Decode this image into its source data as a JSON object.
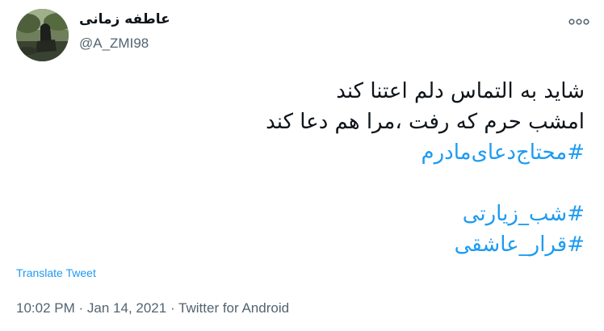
{
  "colors": {
    "text": "#0f1419",
    "secondary": "#536471",
    "link": "#1d9bf0",
    "background": "#ffffff"
  },
  "user": {
    "display_name": "عاطفه زمانی",
    "handle": "@A_ZMI98",
    "avatar_icon": "user-avatar-photo"
  },
  "header": {
    "more_icon": "more-dots-icon"
  },
  "tweet": {
    "lines": [
      "شاید به التماس دلم اعتنا کند",
      "امشب حرم که رفت ،مرا هم دعا کند"
    ],
    "hashtags": [
      "#محتاج‌دعای‌مادرم",
      "#شب_زیارتی",
      "#قرار_عاشقی"
    ]
  },
  "actions": {
    "translate_label": "Translate Tweet"
  },
  "meta": {
    "time": "10:02 PM",
    "date": "Jan 14, 2021",
    "separator": "·",
    "source": "Twitter for Android"
  }
}
